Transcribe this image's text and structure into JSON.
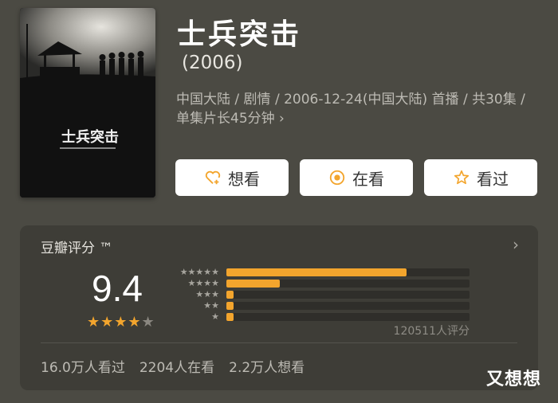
{
  "movie": {
    "title": "士兵突击",
    "year": "(2006)",
    "meta": "中国大陆 / 剧情 / 2006-12-24(中国大陆) 首播 / 共30集 / 单集片长45分钟",
    "chevron": "›",
    "poster_text": "士兵突击"
  },
  "actions": {
    "want_label": "想看",
    "watching_label": "在看",
    "watched_label": "看过"
  },
  "rating": {
    "title": "豆瓣评分 ™",
    "arrow": "›",
    "score": "9.4",
    "stars_filled": "★★★★",
    "stars_half": "★",
    "count": "120511人评分",
    "distribution": [
      {
        "stars": "★★★★★",
        "percent": 74
      },
      {
        "stars": "★★★★",
        "percent": 22
      },
      {
        "stars": "★★★",
        "percent": 3
      },
      {
        "stars": "★★",
        "percent": 1
      },
      {
        "stars": "★",
        "percent": 1
      }
    ]
  },
  "stats": {
    "watched": "16.0万人看过",
    "watching": "2204人在看",
    "want": "2.2万人想看"
  },
  "watermark": "又想想",
  "colors": {
    "accent": "#f3a52d",
    "background": "#4b4a43",
    "card": "#3e3d37"
  }
}
